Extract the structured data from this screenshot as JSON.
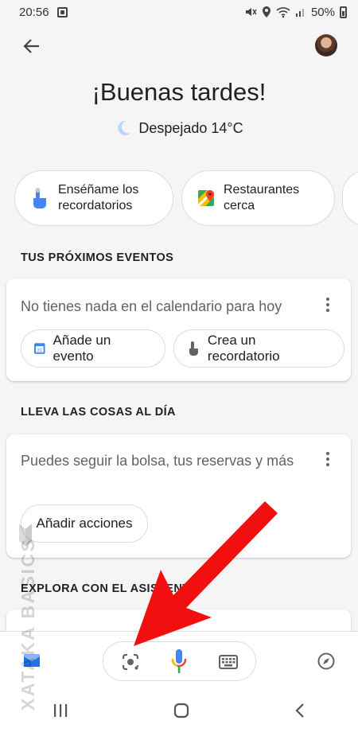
{
  "status_bar": {
    "time": "20:56",
    "battery": "50%"
  },
  "header": {
    "back_icon": "arrow-back-icon",
    "avatar_icon": "user-avatar"
  },
  "greeting": "¡Buenas tardes!",
  "weather": {
    "icon": "moon-icon",
    "text": "Despejado 14°C"
  },
  "chips": [
    {
      "label": "Enséñame los\nrecordatorios",
      "icon": "hand-pointer-icon"
    },
    {
      "label": "Restaurantes\ncerca",
      "icon": "maps-icon"
    },
    {
      "label": "",
      "icon": ""
    }
  ],
  "events": {
    "title": "TUS PRÓXIMOS EVENTOS",
    "message": "No tienes nada en el calendario para hoy",
    "add_event": "Añade un evento",
    "add_event_day": "31",
    "add_reminder": "Crea un recordatorio"
  },
  "stay_updated": {
    "title": "LLEVA LAS COSAS AL DÍA",
    "message": "Puedes seguir la bolsa, tus reservas y más",
    "add_actions": "Añadir acciones"
  },
  "explore": {
    "title": "EXPLORA CON EL ASISTENTE"
  },
  "bottom_bar": {
    "snapshot_icon": "inbox-icon",
    "lens_icon": "lens-icon",
    "mic_icon": "mic-icon",
    "keyboard_icon": "keyboard-icon",
    "compass_icon": "compass-icon"
  },
  "nav": {
    "recents_icon": "recents-icon",
    "home_icon": "home-icon",
    "back_icon": "nav-back-icon"
  },
  "watermark": "XATAKA BASICS",
  "colors": {
    "accent": "#1a73e8",
    "arrow": "#f20f0f",
    "card_bg": "#ffffff",
    "page_bg": "#f5f5f5"
  }
}
